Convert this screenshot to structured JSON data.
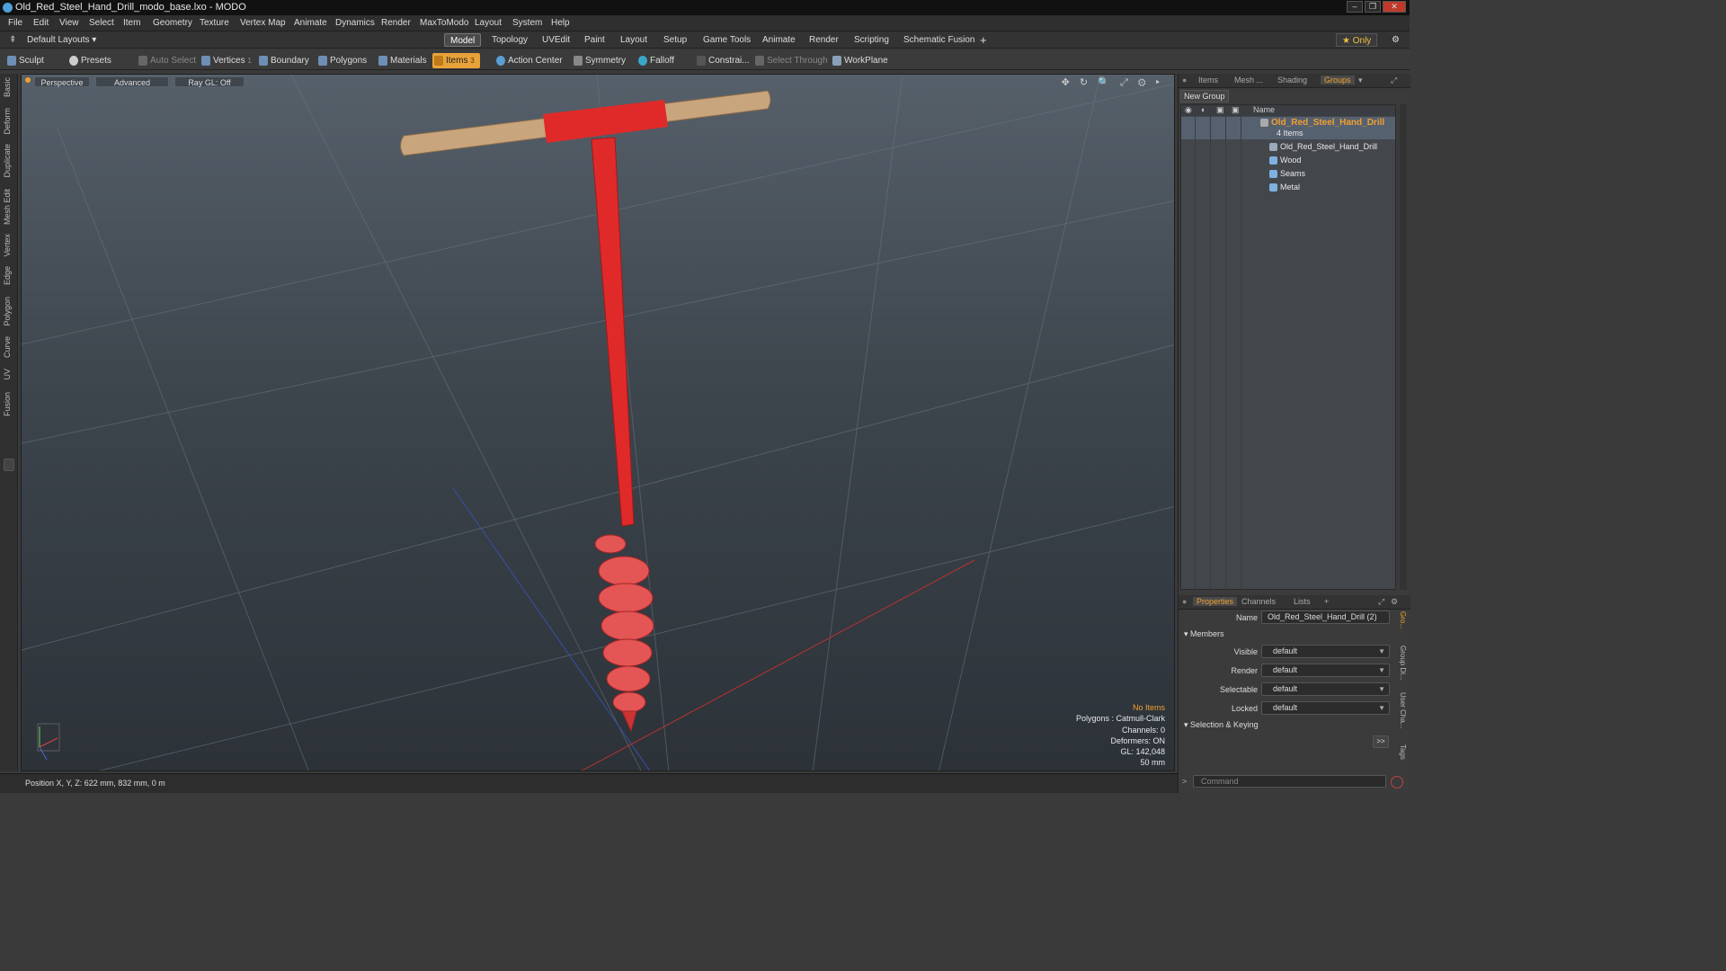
{
  "window": {
    "title": "Old_Red_Steel_Hand_Drill_modo_base.lxo - MODO",
    "buttons": [
      "–",
      "❐",
      "✕"
    ]
  },
  "menu": [
    "File",
    "Edit",
    "View",
    "Select",
    "Item",
    "Geometry",
    "Texture",
    "Vertex Map",
    "Animate",
    "Dynamics",
    "Render",
    "MaxToModo",
    "Layout",
    "System",
    "Help"
  ],
  "layouts": {
    "label": "Default Layouts ▾",
    "only": "★ Only",
    "add": "+",
    "gear": "⚙"
  },
  "modes": [
    "Model",
    "Topology",
    "UVEdit",
    "Paint",
    "Layout",
    "Setup",
    "Game Tools",
    "Animate",
    "Render",
    "Scripting",
    "Schematic Fusion"
  ],
  "toolbar": {
    "sculpt": "Sculpt",
    "presets": "Presets",
    "auto_select": "Auto Select",
    "vertices": "Vertices",
    "vertices_count": "1",
    "boundary": "Boundary",
    "polygons": "Polygons",
    "materials": "Materials",
    "items": "Items",
    "items_count": "3",
    "action_center": "Action Center",
    "symmetry": "Symmetry",
    "falloff": "Falloff",
    "constrain": "Constrai...",
    "select_through": "Select Through",
    "workplane": "WorkPlane"
  },
  "left_tabs": [
    "Basic",
    "Deform",
    "Duplicate",
    "Mesh Edit",
    "Vertex",
    "Edge",
    "Polygon",
    "Curve",
    "UV",
    "Fusion"
  ],
  "viewport": {
    "view": "Perspective",
    "shading": "Advanced",
    "raygl": "Ray GL: Off",
    "icons": "✥ ↻ 🔍 ⤢ ⚙ ▸",
    "stats": {
      "no_items": "No Items",
      "polygons": "Polygons : Catmull-Clark",
      "channels": "Channels: 0",
      "deformers": "Deformers: ON",
      "gl": "GL: 142,048",
      "size": "50 mm"
    }
  },
  "status": {
    "position": "Position X, Y, Z:   622 mm, 832 mm, 0 m"
  },
  "panel_tabs": [
    "Items",
    "Mesh ...",
    "Shading",
    "Groups"
  ],
  "groups": {
    "new_group": "New Group",
    "name_header": "Name",
    "group_name": "Old_Red_Steel_Hand_Drill",
    "group_count": "4 Items",
    "members": [
      "Old_Red_Steel_Hand_Drill",
      "Wood",
      "Seams",
      "Metal"
    ]
  },
  "prop_tabs": [
    "Properties",
    "Channels",
    "Lists",
    "+"
  ],
  "properties": {
    "name_label": "Name",
    "name_value": "Old_Red_Steel_Hand_Drill (2)",
    "members_section": "Members",
    "rows": [
      {
        "label": "Visible",
        "value": "default"
      },
      {
        "label": "Render",
        "value": "default"
      },
      {
        "label": "Selectable",
        "value": "default"
      },
      {
        "label": "Locked",
        "value": "default"
      }
    ],
    "keying_section": "Selection & Keying",
    "more": ">>",
    "side_tabs": [
      "Gro...",
      "Group Di...",
      "User Cha...",
      "Tags"
    ]
  },
  "command": {
    "placeholder": "Command"
  },
  "colors": {
    "accent": "#f0a030",
    "drill_red": "#e02a2a",
    "wood": "#c9a57e"
  }
}
